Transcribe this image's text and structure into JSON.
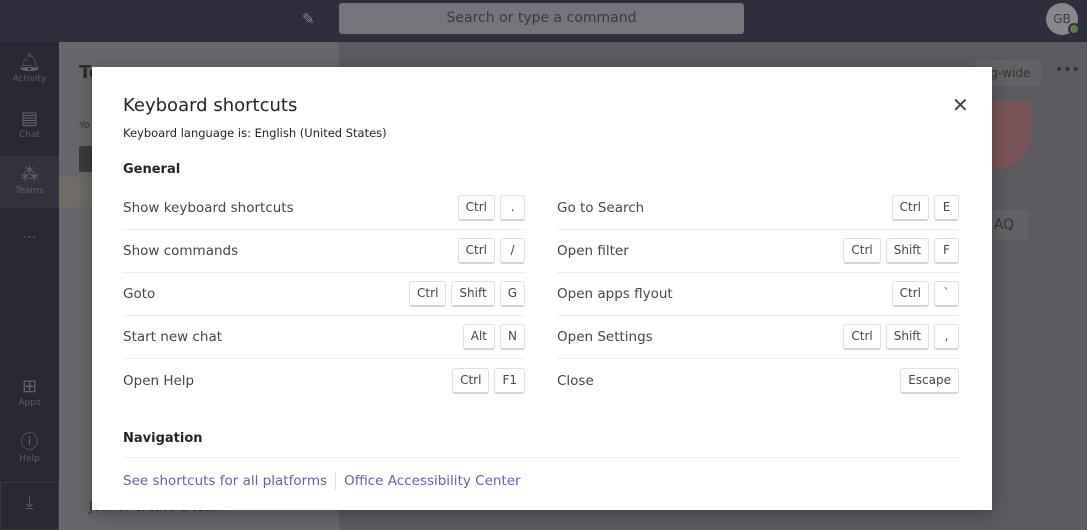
{
  "topbar": {
    "search_placeholder": "Search or type a command",
    "avatar_initials": "GB"
  },
  "rail": [
    {
      "label": "Activity",
      "icon": "bell-icon"
    },
    {
      "label": "Chat",
      "icon": "chat-icon"
    },
    {
      "label": "Teams",
      "icon": "teams-icon"
    },
    {
      "label": "...",
      "icon": "more-icon"
    },
    {
      "label": "Apps",
      "icon": "apps-icon"
    },
    {
      "label": "Help",
      "icon": "help-icon"
    }
  ],
  "background": {
    "left_title": "Te",
    "left_text": "Yo",
    "join_text": "Join or create a team",
    "pill": "rg-wide",
    "faq": "AQ"
  },
  "modal": {
    "title": "Keyboard shortcuts",
    "language": "Keyboard language is: English (United States)",
    "general_heading": "General",
    "navigation_heading": "Navigation",
    "left": [
      {
        "label": "Show keyboard shortcuts",
        "keys": [
          "Ctrl",
          "."
        ]
      },
      {
        "label": "Show commands",
        "keys": [
          "Ctrl",
          "/"
        ]
      },
      {
        "label": "Goto",
        "keys": [
          "Ctrl",
          "Shift",
          "G"
        ]
      },
      {
        "label": "Start new chat",
        "keys": [
          "Alt",
          "N"
        ]
      },
      {
        "label": "Open Help",
        "keys": [
          "Ctrl",
          "F1"
        ]
      }
    ],
    "right": [
      {
        "label": "Go to Search",
        "keys": [
          "Ctrl",
          "E"
        ]
      },
      {
        "label": "Open filter",
        "keys": [
          "Ctrl",
          "Shift",
          "F"
        ]
      },
      {
        "label": "Open apps flyout",
        "keys": [
          "Ctrl",
          "`"
        ]
      },
      {
        "label": "Open Settings",
        "keys": [
          "Ctrl",
          "Shift",
          ","
        ]
      },
      {
        "label": "Close",
        "keys": [
          "Escape"
        ]
      }
    ],
    "links": [
      "See shortcuts for all platforms",
      "Office Accessibility Center"
    ]
  },
  "colors": {
    "link": "#6264a7",
    "topbar": "#2f2e3c",
    "rail": "#2a2933"
  }
}
